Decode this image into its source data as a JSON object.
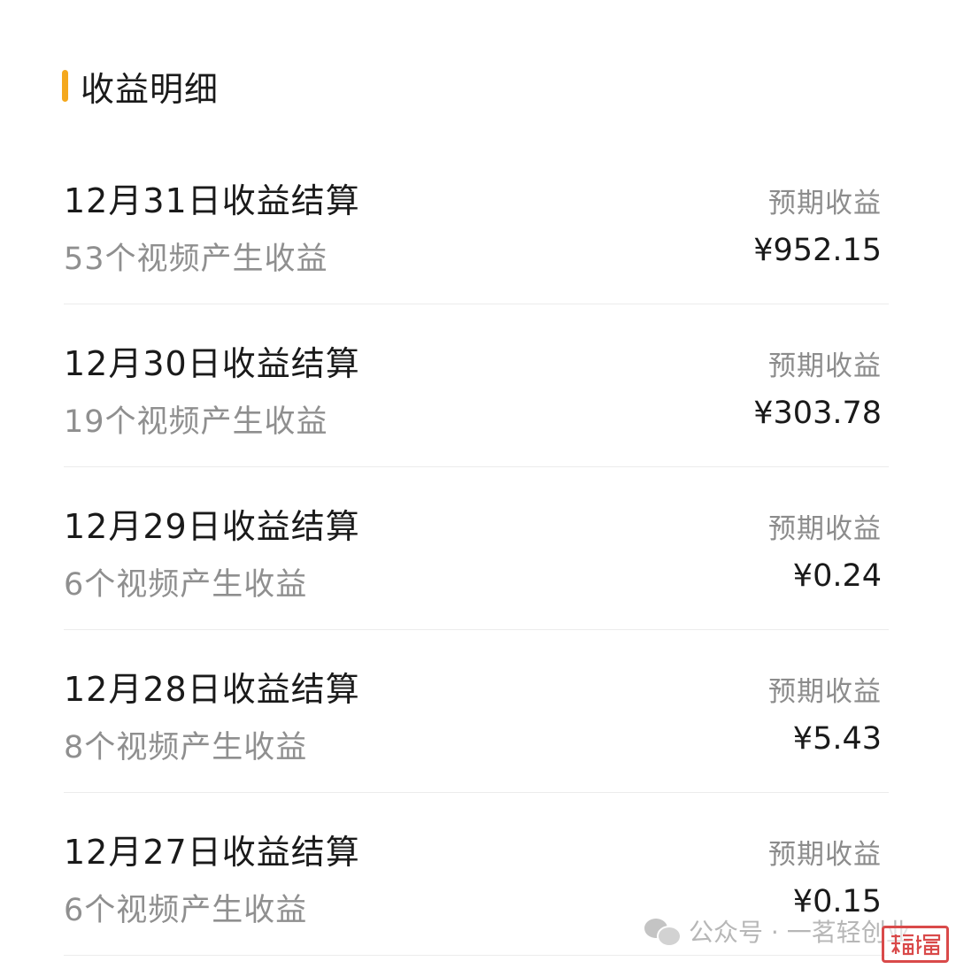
{
  "header": {
    "title": "收益明细",
    "accent_color": "#f4a81d"
  },
  "rows": [
    {
      "title": "12月31日收益结算",
      "subtitle": "53个视频产生收益",
      "label": "预期收益",
      "amount": "¥952.15"
    },
    {
      "title": "12月30日收益结算",
      "subtitle": "19个视频产生收益",
      "label": "预期收益",
      "amount": "¥303.78"
    },
    {
      "title": "12月29日收益结算",
      "subtitle": "6个视频产生收益",
      "label": "预期收益",
      "amount": "¥0.24"
    },
    {
      "title": "12月28日收益结算",
      "subtitle": "8个视频产生收益",
      "label": "预期收益",
      "amount": "¥5.43"
    },
    {
      "title": "12月27日收益结算",
      "subtitle": "6个视频产生收益",
      "label": "预期收益",
      "amount": "¥0.15"
    }
  ],
  "watermark": {
    "text": "公众号 · 一茗轻创业",
    "icon": "wechat-icon"
  },
  "seal": {
    "text": "㯷㯼",
    "color": "#d94a4a"
  }
}
